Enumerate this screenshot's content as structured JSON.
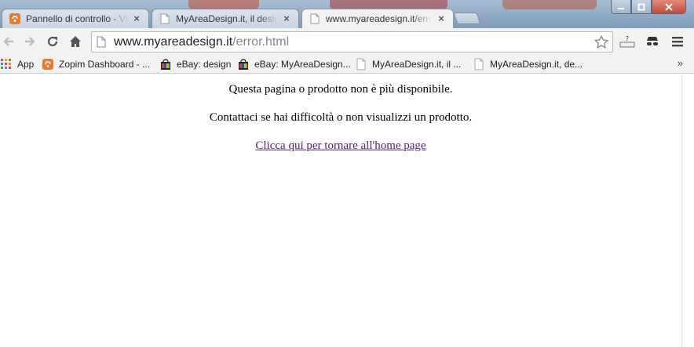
{
  "window": {
    "tabs": [
      {
        "label": "Pannello di controllo - Vis",
        "icon": "zopim-icon",
        "active": false
      },
      {
        "label": "MyAreaDesign.it, il design",
        "icon": "page-icon",
        "active": false
      },
      {
        "label": "www.myareadesign.it/error.",
        "icon": "page-icon",
        "active": true
      }
    ],
    "tab_close_glyph": "×"
  },
  "toolbar": {
    "url_host": "www.myareadesign.it",
    "url_path": "/error.html"
  },
  "bookmarks": {
    "items": [
      {
        "label": "App",
        "icon": "apps-grid-icon"
      },
      {
        "label": "Zopim Dashboard - ...",
        "icon": "zopim-icon"
      },
      {
        "label": "eBay: design",
        "icon": "ebay-bag-icon"
      },
      {
        "label": "eBay: MyAreaDesign...",
        "icon": "ebay-bag-icon"
      },
      {
        "label": "MyAreaDesign.it, il ...",
        "icon": "page-icon"
      },
      {
        "label": "MyAreaDesign.it, de...",
        "icon": "page-icon"
      }
    ],
    "overflow": "»"
  },
  "page": {
    "line1": "Questa pagina o prodotto non è più disponibile.",
    "line2": "Contattaci se hai difficoltà o non visualizzi un prodotto.",
    "link": "Clicca qui per tornare all'home page"
  },
  "colors": {
    "accent_orange": "#f0782a",
    "link_visited": "#551a8b",
    "ebay_red": "#e53238",
    "ebay_blue": "#0064d2",
    "ebay_yellow": "#f5af02",
    "ebay_green": "#86b817"
  }
}
